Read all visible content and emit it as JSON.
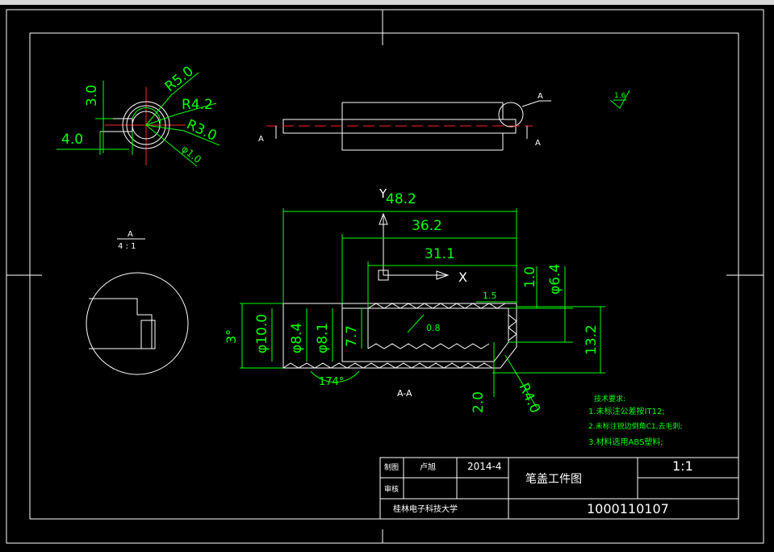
{
  "drawing": {
    "top_view": {
      "dims": [
        "3.0",
        "4.0",
        "R5.0",
        "R4.2",
        "R3.0",
        "φ1.0"
      ]
    },
    "side_view": {
      "section_marks": [
        "A",
        "A",
        "A"
      ]
    },
    "roughness": "1.6",
    "detail_view": {
      "label": "A",
      "scale": "4 : 1"
    },
    "section_view": {
      "label": "A-A",
      "dims": {
        "d48_2": "48.2",
        "d36_2": "36.2",
        "d31_1": "31.1",
        "d1_0": "1.0",
        "phi6_4": "φ6.4",
        "d1_5": "1.5",
        "phi10_0": "φ10.0",
        "phi8_4": "φ8.4",
        "phi8_1": "φ8.1",
        "d7_7": "7.7",
        "deg3": "3°",
        "d0_8": "0.8",
        "d13_2": "13.2",
        "deg174": "174°",
        "d2_0": "2.0",
        "r4_0": "R4.0"
      },
      "axis_labels": [
        "Y",
        "X"
      ]
    },
    "tech_notes": {
      "title": "技术要求:",
      "items": [
        "1.未标注公差按IT12;",
        "2.未标注锐边倒角C1,去毛刺;",
        "3.材料选用ABS塑料;"
      ]
    },
    "title_block": {
      "row1_label": "制图",
      "designer": "卢旭",
      "date": "2014-4",
      "drawing_title": "笔盖工件图",
      "scale": "1:1",
      "row2_label": "审核",
      "school": "桂林电子科技大学",
      "drawing_number": "1000110107"
    }
  },
  "colors": {
    "background": "#000000",
    "dimension": "#00ff00",
    "outline": "#ffffff",
    "centerline": "#ff2020"
  }
}
